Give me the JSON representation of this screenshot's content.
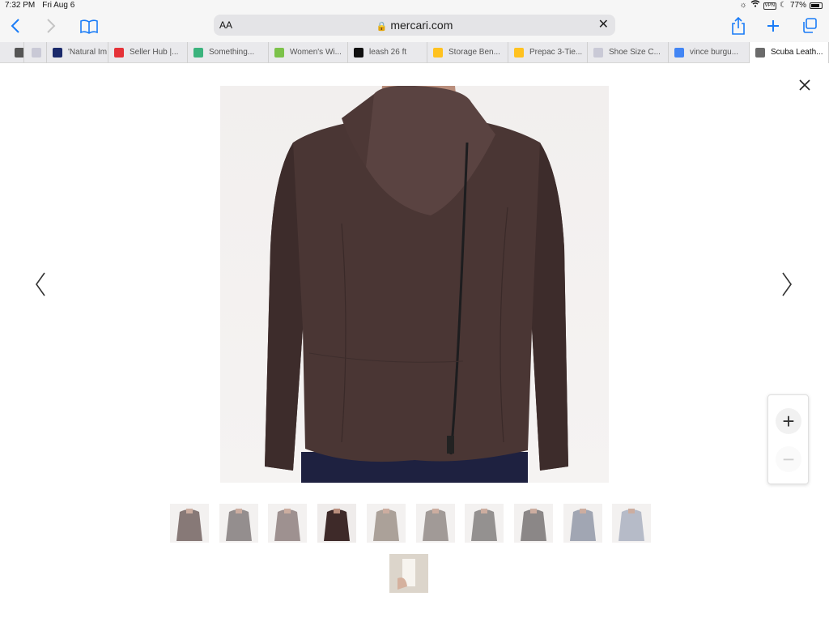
{
  "status_bar": {
    "time": "7:32 PM",
    "date": "Fri Aug 6",
    "vpn": "VPN",
    "battery": "77%"
  },
  "toolbar": {
    "reader_label": "AA",
    "url": "mercari.com"
  },
  "tabs": [
    {
      "title": "",
      "favicon": "arrow",
      "color": "#555555"
    },
    {
      "title": "",
      "favicon": "B",
      "color": "#c9c9d6"
    },
    {
      "title": "'Natural Im",
      "favicon": "NPT",
      "color": "#1b2a6b"
    },
    {
      "title": "Seller Hub |...",
      "favicon": "ebay",
      "color": "#e53238"
    },
    {
      "title": "Something...",
      "favicon": "house",
      "color": "#3bb37d"
    },
    {
      "title": "Women's Wi...",
      "favicon": "w",
      "color": "#7cc24a"
    },
    {
      "title": "leash 26 ft",
      "favicon": "a",
      "color": "#111111"
    },
    {
      "title": "Storage Ben...",
      "favicon": "walmart",
      "color": "#ffc220"
    },
    {
      "title": "Prepac 3-Tie...",
      "favicon": "walmart",
      "color": "#ffc220"
    },
    {
      "title": "Shoe Size C...",
      "favicon": "C",
      "color": "#c9c9d6"
    },
    {
      "title": "vince burgu...",
      "favicon": "G",
      "color": "#4285f4"
    },
    {
      "title": "Scuba Leath...",
      "favicon": "x",
      "color": "#6b6b6b",
      "active": true
    }
  ],
  "viewer": {
    "thumb_count": 11,
    "active_thumb": 4
  },
  "colors": {
    "accent": "#1a7cf7",
    "jacket": "#4a3634",
    "jeans": "#1e2140"
  }
}
